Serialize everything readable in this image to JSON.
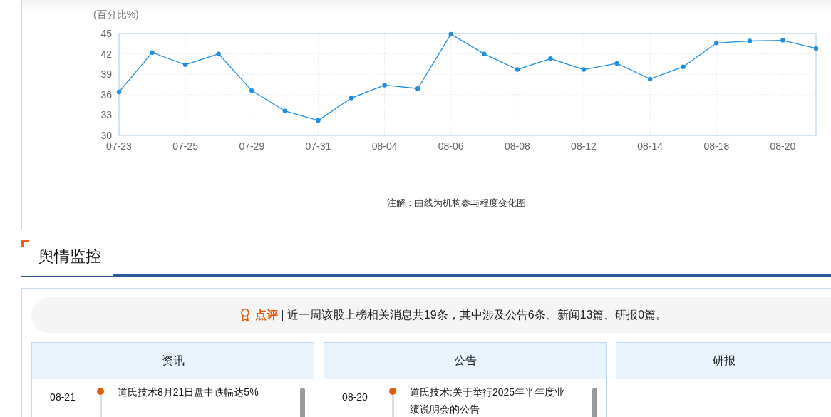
{
  "trend_chart": {
    "unit_label": "(百分比%)",
    "note": "注解：曲线为机构参与程度变化图",
    "chart_data": {
      "type": "line",
      "categories": [
        "07-23",
        null,
        "07-25",
        null,
        "07-29",
        null,
        "07-31",
        null,
        "08-04",
        null,
        "08-06",
        null,
        "08-08",
        null,
        "08-12",
        null,
        "08-14",
        null,
        "08-18",
        null,
        "08-20",
        null
      ],
      "grid": true,
      "series": [
        {
          "color": "#1e8ee0",
          "marker": "circle",
          "values": [
            36.4,
            42.2,
            40.4,
            42.0,
            36.6,
            33.6,
            32.2,
            35.5,
            37.4,
            36.9,
            44.9,
            42.0,
            39.7,
            41.3,
            39.7,
            40.6,
            38.3,
            40.1,
            43.6,
            43.9,
            44.0,
            42.8
          ]
        }
      ],
      "ylim": [
        30,
        45
      ],
      "yticks": [
        30,
        33,
        36,
        39,
        42,
        45
      ]
    }
  },
  "sentiment": {
    "title": "舆情监控",
    "summary": "**点评** | 近一周该股上榜相关消息共19条，其中涉及公告6条、新闻13篇、研报0篇。",
    "columns": [
      {
        "title": "资讯",
        "items": [
          {
            "date": "08-21",
            "title": "道氏技术8月21日盘中跌幅达5%"
          }
        ]
      },
      {
        "title": "公告",
        "items": [
          {
            "date": "08-20",
            "title": "道氏技术:关于举行2025年半年度业绩说明会的公告"
          }
        ]
      },
      {
        "title": "研报"
      }
    ]
  }
}
